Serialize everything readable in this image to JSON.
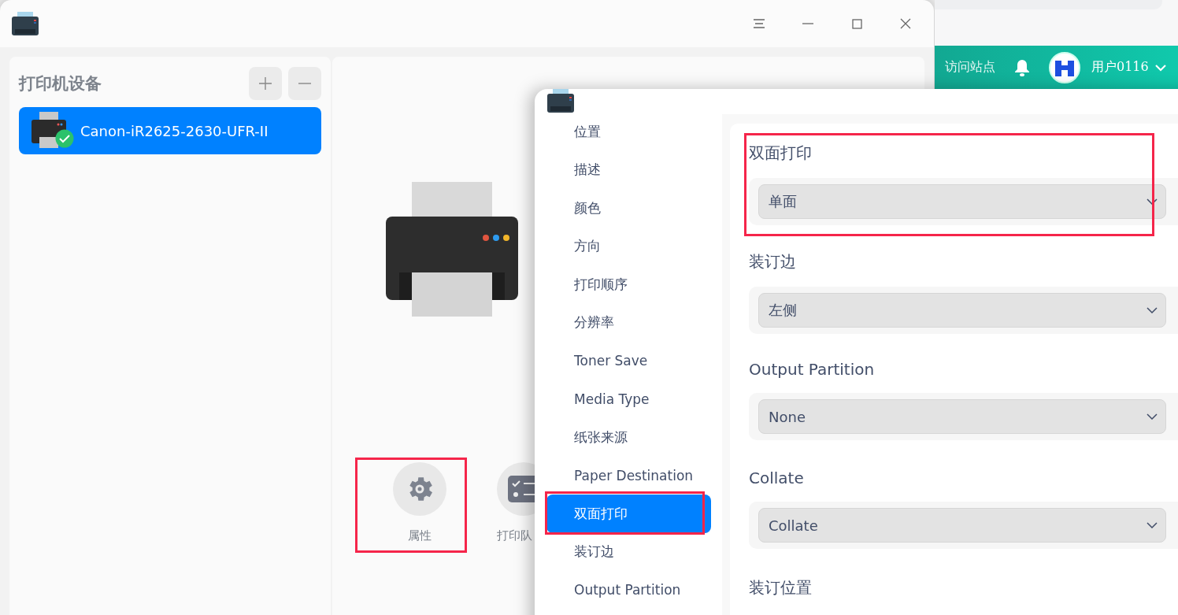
{
  "main_window": {
    "sidebar": {
      "title": "打印机设备",
      "devices": [
        {
          "name": "Canon-iR2625-2630-UFR-II",
          "selected": true,
          "ready": true
        }
      ]
    },
    "actions": [
      {
        "kind": "settings",
        "label": "属性",
        "highlighted": true
      },
      {
        "kind": "queue",
        "label": "打印队",
        "highlighted": false
      }
    ]
  },
  "web_header": {
    "link": "访问站点",
    "user": "用户0116"
  },
  "dialog": {
    "nav": [
      {
        "label": "位置",
        "selected": false,
        "highlighted": false
      },
      {
        "label": "描述",
        "selected": false,
        "highlighted": false
      },
      {
        "label": "颜色",
        "selected": false,
        "highlighted": false
      },
      {
        "label": "方向",
        "selected": false,
        "highlighted": false
      },
      {
        "label": "打印顺序",
        "selected": false,
        "highlighted": false
      },
      {
        "label": "分辨率",
        "selected": false,
        "highlighted": false
      },
      {
        "label": "Toner Save",
        "selected": false,
        "highlighted": false
      },
      {
        "label": "Media Type",
        "selected": false,
        "highlighted": false
      },
      {
        "label": "纸张来源",
        "selected": false,
        "highlighted": false
      },
      {
        "label": "Paper Destination",
        "selected": false,
        "highlighted": false
      },
      {
        "label": "双面打印",
        "selected": true,
        "highlighted": true
      },
      {
        "label": "装订边",
        "selected": false,
        "highlighted": false
      },
      {
        "label": "Output Partition",
        "selected": false,
        "highlighted": false
      }
    ],
    "sections": [
      {
        "title": "双面打印",
        "value": "单面",
        "highlighted": true
      },
      {
        "title": "装订边",
        "value": "左侧",
        "highlighted": false
      },
      {
        "title": "Output Partition",
        "value": "None",
        "highlighted": false
      },
      {
        "title": "Collate",
        "value": "Collate",
        "highlighted": false
      },
      {
        "title": "装订位置",
        "highlighted": false
      }
    ]
  }
}
